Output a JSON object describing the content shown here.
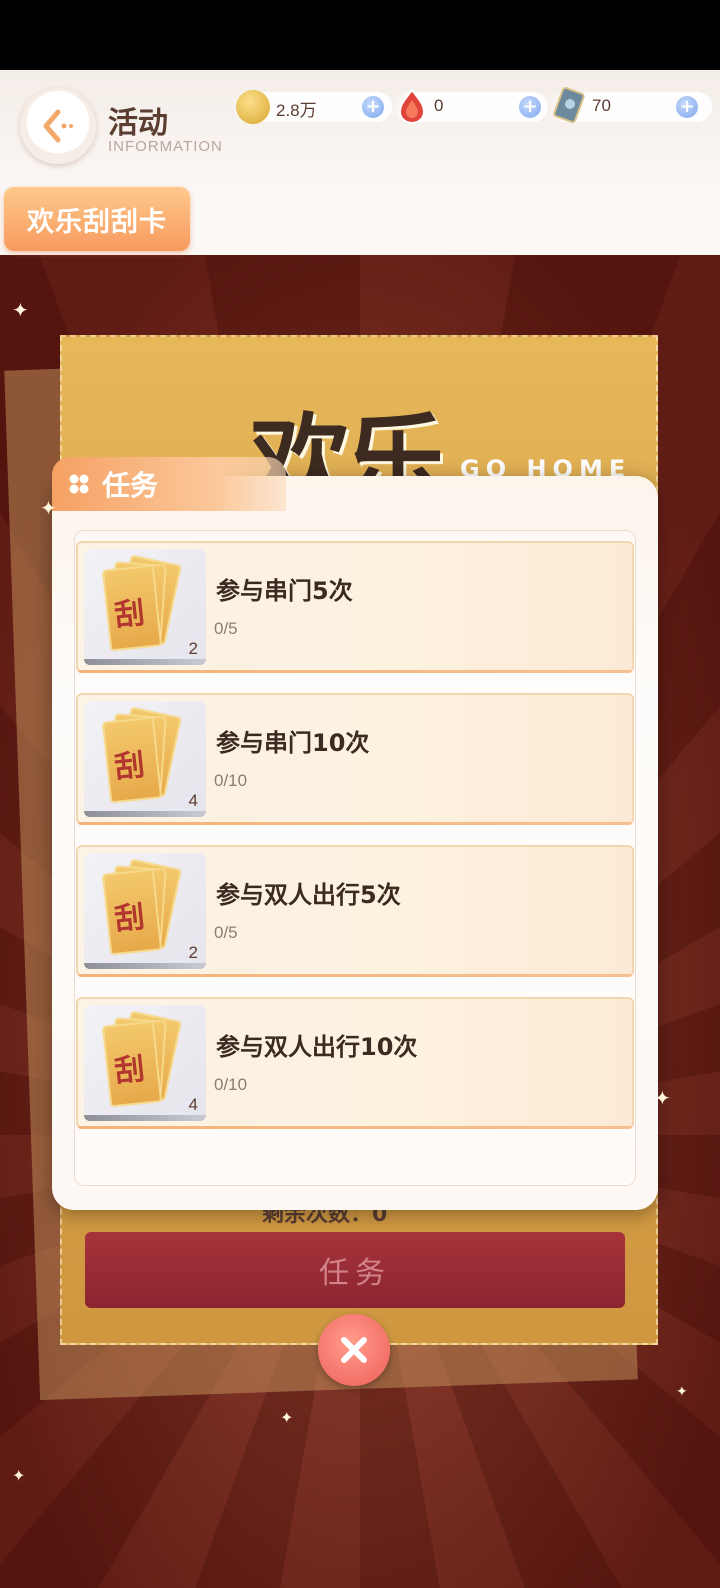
{
  "header": {
    "title": "活动",
    "subtitle": "INFORMATION",
    "currencies": [
      {
        "icon": "coin-icon",
        "value": "2.8万"
      },
      {
        "icon": "red-gem-icon",
        "value": "0"
      },
      {
        "icon": "card-ticket-icon",
        "value": "70"
      }
    ]
  },
  "tabs": [
    {
      "label": "欢乐刮刮卡",
      "active": true
    }
  ],
  "background_card": {
    "title": "欢乐",
    "subtitle": "GO HOME",
    "count_label": "剩余次数：0",
    "button_label": "任务"
  },
  "popup": {
    "title": "任务",
    "tasks": [
      {
        "name": "参与串门5次",
        "progress": "0/5",
        "reward_count": "2"
      },
      {
        "name": "参与串门10次",
        "progress": "0/10",
        "reward_count": "4"
      },
      {
        "name": "参与双人出行5次",
        "progress": "0/5",
        "reward_count": "2"
      },
      {
        "name": "参与双人出行10次",
        "progress": "0/10",
        "reward_count": "4"
      }
    ]
  },
  "colors": {
    "accent": "#f79a5f",
    "close": "#ee5e5a",
    "plus": "#7ea8ef"
  }
}
